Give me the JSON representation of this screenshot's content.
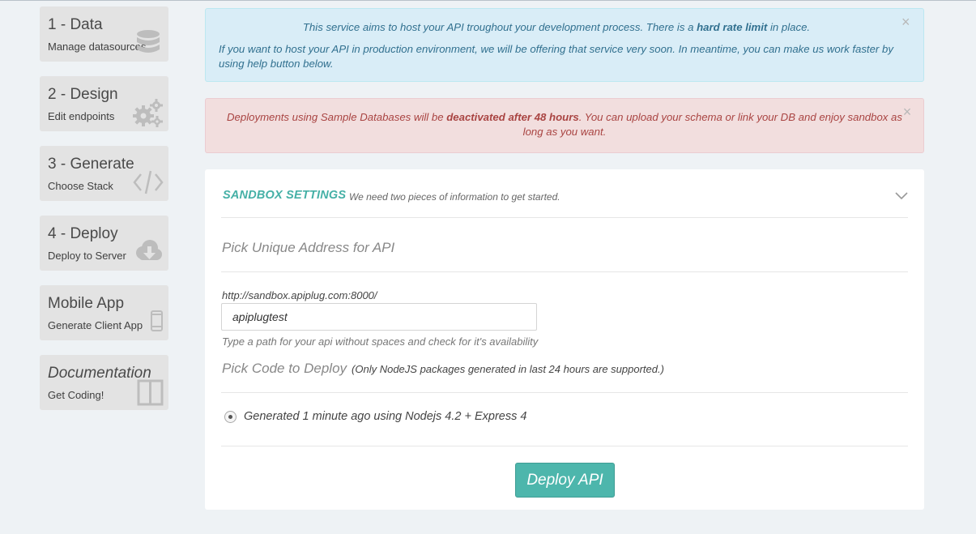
{
  "sidebar": {
    "steps": [
      {
        "title": "1 - Data",
        "subtitle": "Manage datasources",
        "icon": "database-icon"
      },
      {
        "title": "2 - Design",
        "subtitle": "Edit endpoints",
        "icon": "gears-icon"
      },
      {
        "title": "3 - Generate",
        "subtitle": "Choose Stack",
        "icon": "code-icon"
      },
      {
        "title": "4 - Deploy",
        "subtitle": "Deploy to Server",
        "icon": "cloud-download-icon"
      },
      {
        "title": "Mobile App",
        "subtitle": "Generate Client App",
        "icon": "mobile-phone-icon"
      },
      {
        "title": "Documentation",
        "subtitle": "Get Coding!",
        "icon": "book-icon"
      }
    ]
  },
  "alerts": {
    "info": {
      "text_before": "This service aims to host your API troughout your development process. There is a ",
      "bold": "hard rate limit",
      "text_after": " in place.",
      "line2": "If you want to host your API in production environment, we will be offering that service very soon. In meantime, you can make us work faster by using help button below.",
      "close": "×"
    },
    "danger": {
      "text_before": "Deployments using Sample Databases will be ",
      "bold": "deactivated after 48 hours",
      "text_after": ". You can upload your schema or link your DB and enjoy sandbox as long as you want.",
      "close": "×"
    }
  },
  "sandbox": {
    "title": "SANDBOX SETTINGS",
    "subtitle": "We need two pieces of information to get started.",
    "address_heading": "Pick Unique Address for API",
    "base_url": "http://sandbox.apiplug.com:8000/",
    "path_value": "apiplugtest",
    "path_help": "Type a path for your api without spaces and check for it's availability",
    "code_heading": "Pick Code to Deploy",
    "code_note": "(Only NodeJS packages generated in last 24 hours are supported.)",
    "option_label": "Generated 1 minute ago using Nodejs 4.2 + Express 4",
    "deploy_label": "Deploy API"
  },
  "colors": {
    "accent": "#4db6ac",
    "info_bg": "#d9edf7",
    "danger_bg": "#f2dede",
    "sidebar_bg": "#e3e3e3"
  }
}
